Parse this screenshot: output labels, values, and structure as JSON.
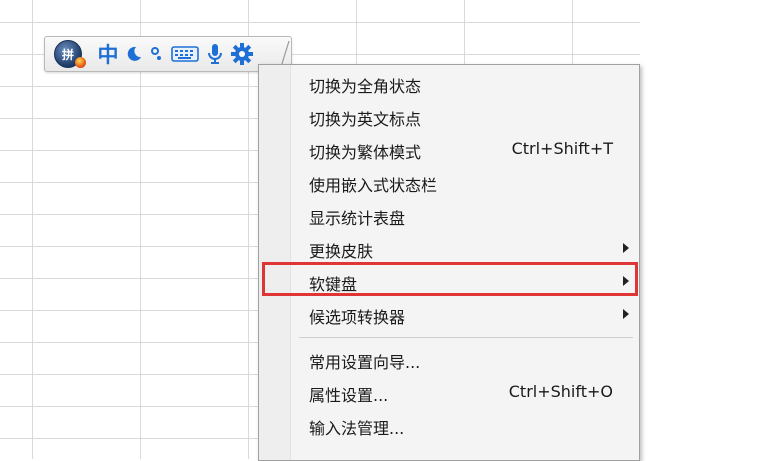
{
  "ime_toolbar": {
    "logo_text": "拼",
    "mode_label": "中",
    "icons": [
      "logo-icon",
      "moon-icon",
      "punctuation-icon",
      "keyboard-icon",
      "microphone-icon",
      "gear-icon"
    ]
  },
  "context_menu": {
    "items": [
      {
        "label": "切换为全角状态",
        "shortcut": ""
      },
      {
        "label": "切换为英文标点",
        "shortcut": ""
      },
      {
        "label": "切换为繁体模式",
        "shortcut": "Ctrl+Shift+T"
      },
      {
        "label": "使用嵌入式状态栏",
        "shortcut": ""
      },
      {
        "label": "显示统计表盘",
        "shortcut": ""
      },
      {
        "label": "更换皮肤",
        "shortcut": "",
        "submenu": true
      },
      {
        "label": "软键盘",
        "shortcut": "",
        "submenu": true,
        "highlighted": true
      },
      {
        "label": "候选项转换器",
        "shortcut": "",
        "submenu": true
      },
      {
        "label": "常用设置向导...",
        "shortcut": ""
      },
      {
        "label": "属性设置...",
        "shortcut": "Ctrl+Shift+O"
      },
      {
        "label": "输入法管理...",
        "shortcut": ""
      }
    ]
  },
  "colors": {
    "accent_blue": "#1f70d6",
    "highlight_border": "#e03535"
  }
}
